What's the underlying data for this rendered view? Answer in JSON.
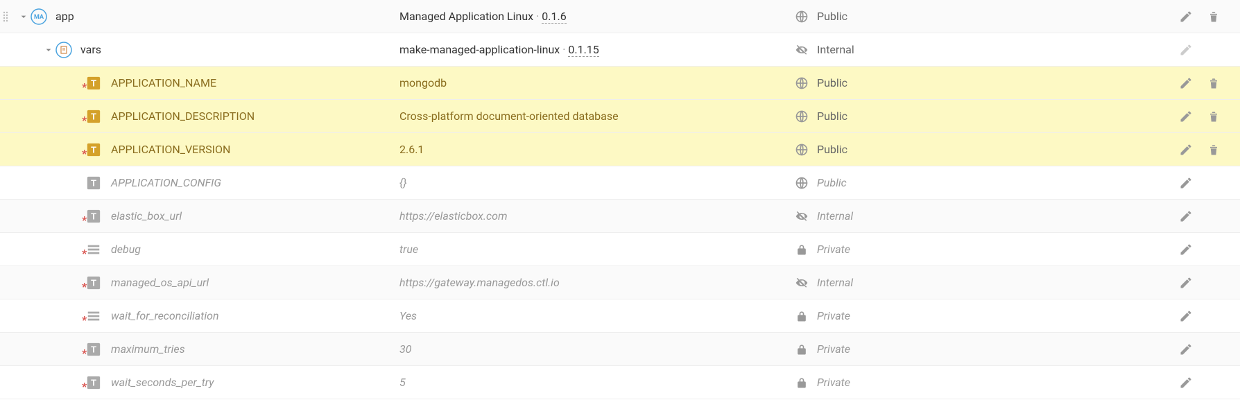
{
  "app_row": {
    "name": "app",
    "value_prefix": "Managed Application Linux",
    "version": "0.1.6",
    "visibility": "Public"
  },
  "vars_row": {
    "name": "vars",
    "value_prefix": "make-managed-application-linux",
    "version": "0.1.15",
    "visibility": "Internal"
  },
  "vars": [
    {
      "name": "APPLICATION_NAME",
      "value": "mongodb",
      "visibility": "Public",
      "highlight": true,
      "dim": false,
      "icon": "text",
      "starred": true,
      "editable": true,
      "deletable": true
    },
    {
      "name": "APPLICATION_DESCRIPTION",
      "value": "Cross-platform document-oriented database",
      "visibility": "Public",
      "highlight": true,
      "dim": false,
      "icon": "text",
      "starred": true,
      "editable": true,
      "deletable": true
    },
    {
      "name": "APPLICATION_VERSION",
      "value": "2.6.1",
      "visibility": "Public",
      "highlight": true,
      "dim": false,
      "icon": "text",
      "starred": true,
      "editable": true,
      "deletable": true
    },
    {
      "name": "APPLICATION_CONFIG",
      "value": "{}",
      "visibility": "Public",
      "highlight": false,
      "dim": true,
      "icon": "text",
      "starred": false,
      "editable": true,
      "deletable": false
    },
    {
      "name": "elastic_box_url",
      "value": "https://elasticbox.com",
      "visibility": "Internal",
      "highlight": false,
      "dim": true,
      "icon": "text",
      "starred": true,
      "editable": true,
      "deletable": false
    },
    {
      "name": "debug",
      "value": "true",
      "visibility": "Private",
      "highlight": false,
      "dim": true,
      "icon": "options",
      "starred": true,
      "editable": true,
      "deletable": false
    },
    {
      "name": "managed_os_api_url",
      "value": "https://gateway.managedos.ctl.io",
      "visibility": "Internal",
      "highlight": false,
      "dim": true,
      "icon": "text",
      "starred": true,
      "editable": true,
      "deletable": false
    },
    {
      "name": "wait_for_reconciliation",
      "value": "Yes",
      "visibility": "Private",
      "highlight": false,
      "dim": true,
      "icon": "options",
      "starred": true,
      "editable": true,
      "deletable": false
    },
    {
      "name": "maximum_tries",
      "value": "30",
      "visibility": "Private",
      "highlight": false,
      "dim": true,
      "icon": "text",
      "starred": true,
      "editable": true,
      "deletable": false
    },
    {
      "name": "wait_seconds_per_try",
      "value": "5",
      "visibility": "Private",
      "highlight": false,
      "dim": true,
      "icon": "text",
      "starred": true,
      "editable": true,
      "deletable": false
    }
  ]
}
